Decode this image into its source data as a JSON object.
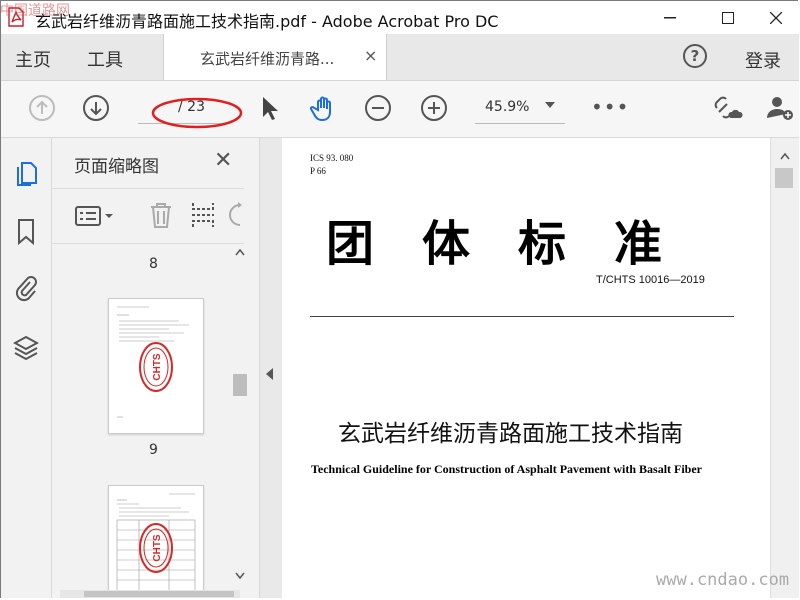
{
  "window": {
    "title": "玄武岩纤维沥青路面施工技术指南.pdf - Adobe Acrobat Pro DC"
  },
  "menu": {
    "home": "主页",
    "tools": "工具",
    "login": "登录",
    "help_glyph": "?"
  },
  "tab": {
    "label": "玄武岩纤维沥青路...",
    "close_glyph": "×"
  },
  "toolbar": {
    "page_indicator": "/ 23",
    "zoom": "45.9%",
    "more": "•••",
    "annotation_color": "#e02020"
  },
  "panel": {
    "title": "页面缩略图",
    "close_glyph": "✕",
    "thumbnails": [
      {
        "page_number": "8"
      },
      {
        "page_number": "9"
      }
    ],
    "stamp_text": "CHTS",
    "stamp_color": "#d22a2a"
  },
  "document": {
    "ics_line1": "ICS  93. 080",
    "ics_line2": "P  66",
    "standard_type": "团　体　标　准",
    "standard_number": "T/CHTS 10016—2019",
    "title_cn": "玄武岩纤维沥青路面施工技术指南",
    "title_en": "Technical Guideline for Construction of Asphalt Pavement with Basalt Fiber"
  },
  "watermarks": {
    "top_left": "中国道路网",
    "bottom_right": "www.cndao.com"
  },
  "colors": {
    "accent_blue": "#1d6ee0",
    "app_red": "#d9252a"
  }
}
